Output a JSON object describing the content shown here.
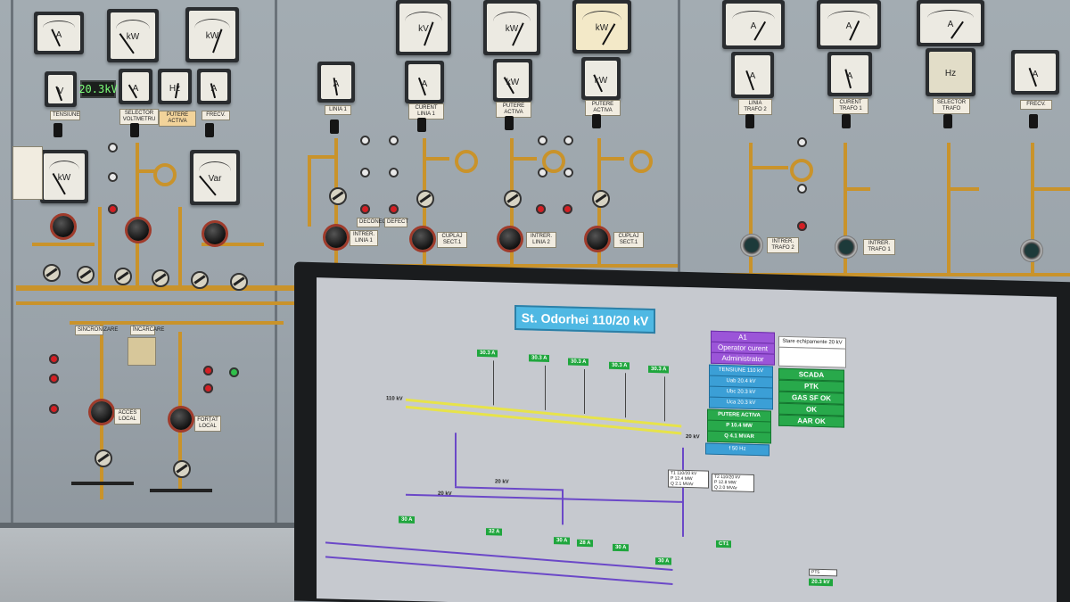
{
  "panel": {
    "digital_display": "20.3kV",
    "labels": {
      "tensiune": "TENSIUNE",
      "selector_voltmetru": "SELECTOR VOLTMETRU",
      "putere_activa_left": "PUTERE ACTIVA",
      "frecv_left": "FRECV.",
      "linia1": "LINIA 1",
      "curent_linia1": "CURENT LINIA 1",
      "putere_activa_mid": "PUTERE ACTIVA",
      "putere_activa_mid2": "PUTERE ACTIVA",
      "cuplaj_sect1_a": "CUPLAJ SECT.1",
      "cuplaj_sect1_b": "CUPLAJ SECT.1",
      "intrer_linia1": "INTRER. LINIA 1",
      "intrer_linia2": "INTRER. LINIA 2",
      "linia_trafo2": "LINIA TRAFO 2",
      "curent_trafo1": "CURENT TRAFO 1",
      "selector_trafo": "SELECTOR TRAFO",
      "frecv_right": "FRECV.",
      "intrer_trafo2": "INTRER. TRAFO 2",
      "intrer_trafo1": "INTRER. TRAFO 1",
      "acces_local": "ACCES LOCAL",
      "forma_local": "FORȚAT LOCAL",
      "incarcare": "ÎNCĂRCARE",
      "sincronizare": "SINCRONIZARE",
      "defect": "DEFECT",
      "deconectat": "DECONECTAT"
    },
    "meter_units": {
      "m1": "A",
      "m2": "kW",
      "m3": "kW",
      "m4": "V",
      "m5": "A",
      "m6": "Hz",
      "m7": "kW",
      "m8": "Var",
      "m9": "A",
      "m10": "kV",
      "m11": "A",
      "m12": "kW",
      "m13": "kW",
      "m14": "A",
      "m15": "kW",
      "m16": "kW",
      "m17": "Hz",
      "m18": "A",
      "m19": "A",
      "m20": "A",
      "m21": "A"
    }
  },
  "screen": {
    "title": "St. Odorhei 110/20 kV",
    "voltage_110": "110 kV",
    "voltage_20_right": "20 kV",
    "voltage_20_a": "20 kV",
    "voltage_20_b": "20 kV",
    "status_panel": {
      "a1": "A1",
      "operator": "Operator curent",
      "administrator": "Administrator",
      "tensiune": "TENSIUNE 110 kV",
      "uab": "Uab 20.4 kV",
      "ubc": "Ubc 20.3 kV",
      "uca": "Uca 20.3 kV",
      "putere_activa": "PUTERE ACTIVA",
      "putere_line1": "P 10.4 MW",
      "putere_line2": "Q 4.1 MVAR",
      "frecventa": "f 50 Hz",
      "stare": "Stare echipamente 20 kV",
      "scada": "SCADA",
      "ptk": "PTK",
      "gas": "GAS  SF   OK",
      "ok": "OK",
      "aar": "AAR  OK"
    },
    "boxes": {
      "b1": "30.3 A",
      "b2": "30.3 A",
      "b3": "30.3 A",
      "b4": "30.3 A",
      "b5": "30.3 A",
      "t1_title": "T1 110/20 kV",
      "t1_p": "P  12.4 MW",
      "t1_q": "Q  2.1 MVAr",
      "t2_title": "T2 110/20 kV",
      "t2_p": "P  12.8 MW",
      "t2_q": "Q  2.0 MVAr",
      "g1": "30 A",
      "g2": "32 A",
      "g3": "30 A",
      "g4": "28 A",
      "g5": "30 A",
      "g6": "30 A",
      "ct1": "CT1",
      "pt5": "PT5",
      "pt5_val": "20.3 kV"
    }
  }
}
